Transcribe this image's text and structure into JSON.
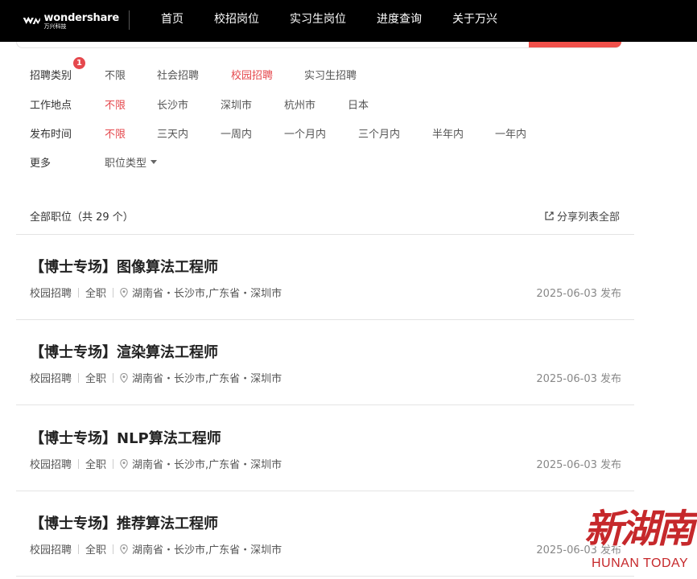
{
  "header": {
    "logo_en": "wondershare",
    "logo_cn": "万兴科技",
    "nav": [
      "首页",
      "校招岗位",
      "实习生岗位",
      "进度查询",
      "关于万兴"
    ]
  },
  "filters": {
    "category": {
      "label": "招聘类别",
      "badge": "1",
      "options": [
        "不限",
        "社会招聘",
        "校园招聘",
        "实习生招聘"
      ],
      "active": "校园招聘"
    },
    "location": {
      "label": "工作地点",
      "options": [
        "不限",
        "长沙市",
        "深圳市",
        "杭州市",
        "日本"
      ],
      "active": "不限"
    },
    "time": {
      "label": "发布时间",
      "options": [
        "不限",
        "三天内",
        "一周内",
        "一个月内",
        "三个月内",
        "半年内",
        "一年内"
      ],
      "active": "不限"
    },
    "more": {
      "label": "更多",
      "dropdown": "职位类型"
    }
  },
  "summary": {
    "text": "全部职位（共 29 个）",
    "share": "分享列表全部"
  },
  "jobs": [
    {
      "title": "【博士专场】图像算法工程师",
      "type": "校园招聘",
      "nature": "全职",
      "location": "湖南省・长沙市,广东省・深圳市",
      "date": "2025-06-03 发布"
    },
    {
      "title": "【博士专场】渲染算法工程师",
      "type": "校园招聘",
      "nature": "全职",
      "location": "湖南省・长沙市,广东省・深圳市",
      "date": "2025-06-03 发布"
    },
    {
      "title": "【博士专场】NLP算法工程师",
      "type": "校园招聘",
      "nature": "全职",
      "location": "湖南省・长沙市,广东省・深圳市",
      "date": "2025-06-03 发布"
    },
    {
      "title": "【博士专场】推荐算法工程师",
      "type": "校园招聘",
      "nature": "全职",
      "location": "湖南省・长沙市,广东省・深圳市",
      "date": "2025-06-03 发布"
    }
  ],
  "watermark": {
    "cn": "新湖南",
    "en": "HUNAN TODAY"
  },
  "colors": {
    "accent": "#e5484d",
    "topbar": "#000000",
    "watermark": "#c6282b"
  }
}
